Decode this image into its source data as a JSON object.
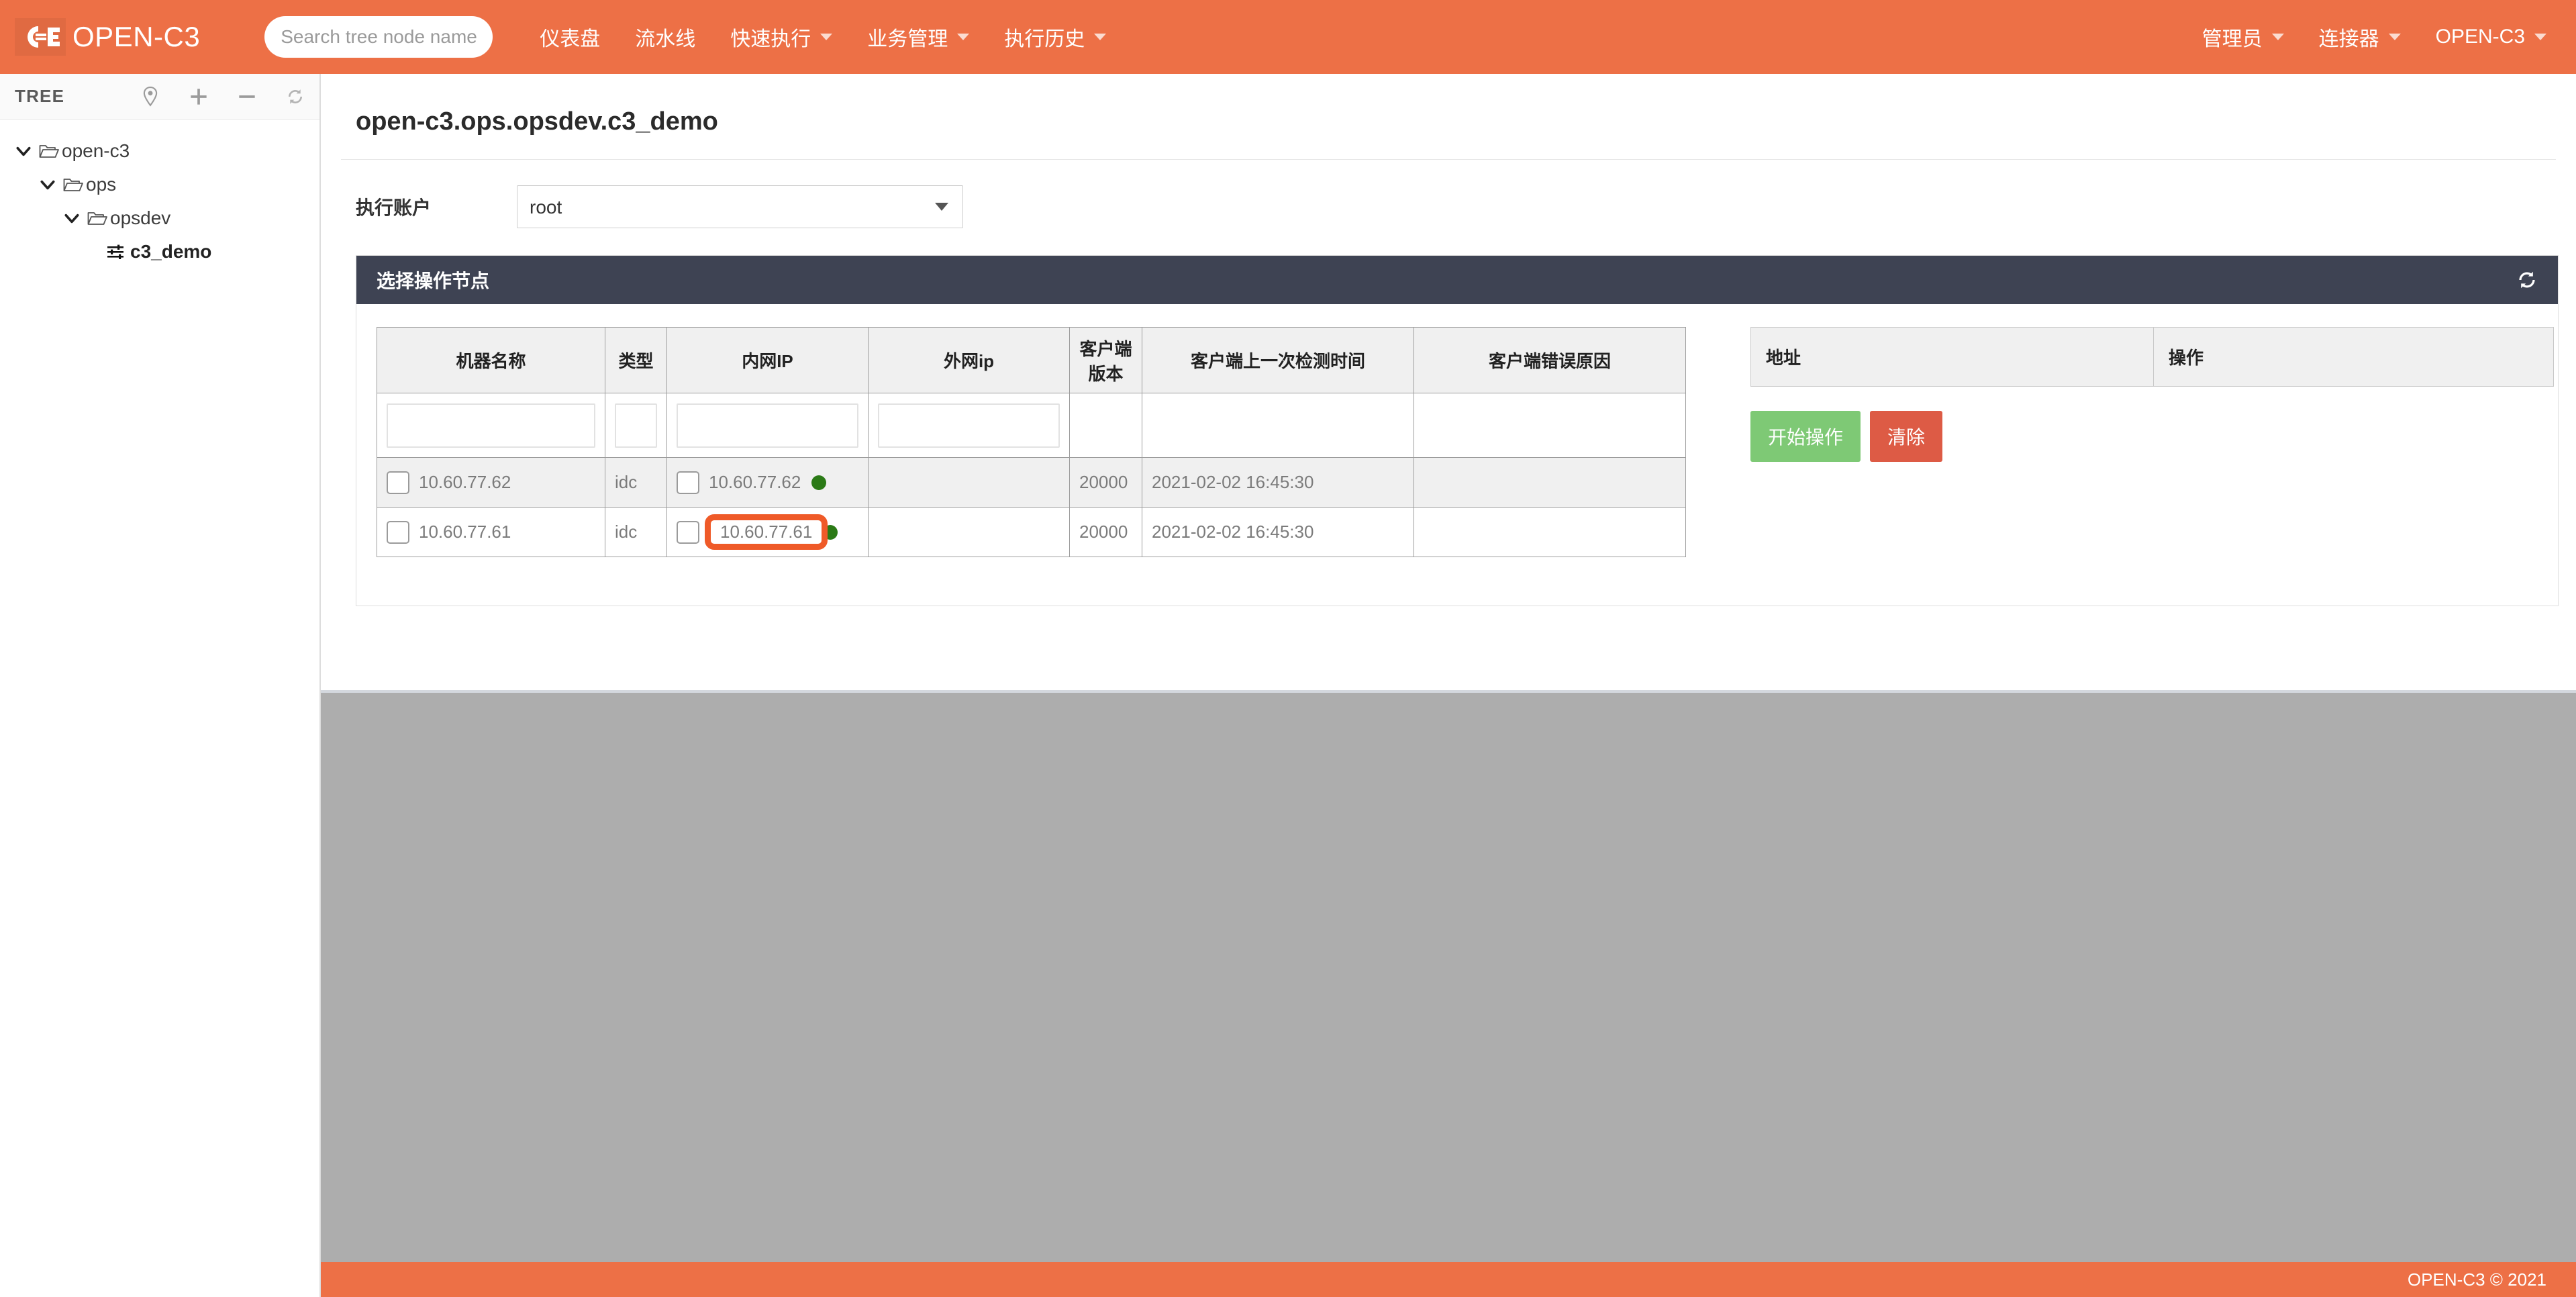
{
  "navbar": {
    "brand": "OPEN-C3",
    "logo_icon": "c3-logo-icon",
    "search": {
      "placeholder": "Search tree node name",
      "value": ""
    },
    "items": [
      {
        "label": "仪表盘",
        "has_caret": false
      },
      {
        "label": "流水线",
        "has_caret": false
      },
      {
        "label": "快速执行",
        "has_caret": true
      },
      {
        "label": "业务管理",
        "has_caret": true
      },
      {
        "label": "执行历史",
        "has_caret": true
      }
    ],
    "right_items": [
      {
        "label": "管理员",
        "has_caret": true
      },
      {
        "label": "连接器",
        "has_caret": true
      },
      {
        "label": "OPEN-C3",
        "has_caret": true
      }
    ]
  },
  "sidebar": {
    "title": "TREE",
    "tools": [
      {
        "icon": "location-pin-icon",
        "name": "locate-node-button"
      },
      {
        "icon": "plus-icon",
        "name": "add-node-button"
      },
      {
        "icon": "minus-icon",
        "name": "remove-node-button"
      },
      {
        "icon": "refresh-icon",
        "name": "refresh-tree-button"
      }
    ],
    "tree": [
      {
        "label": "open-c3",
        "depth": 0,
        "type": "folder",
        "expanded": true
      },
      {
        "label": "ops",
        "depth": 1,
        "type": "folder",
        "expanded": true
      },
      {
        "label": "opsdev",
        "depth": 2,
        "type": "folder",
        "expanded": true
      },
      {
        "label": "c3_demo",
        "depth": 3,
        "type": "leaf",
        "expanded": false
      }
    ]
  },
  "main": {
    "page_title": "open-c3.ops.opsdev.c3_demo",
    "account_form": {
      "label": "执行账户",
      "selected": "root",
      "options": [
        "root"
      ]
    },
    "panel": {
      "title": "选择操作节点",
      "refresh_icon": "refresh-icon"
    },
    "node_table": {
      "headers": [
        "机器名称",
        "类型",
        "内网IP",
        "外网ip",
        "客户端版本",
        "客户端上一次检测时间",
        "客户端错误原因"
      ],
      "filters": [
        "",
        "",
        "",
        ""
      ],
      "rows": [
        {
          "name": "10.60.77.62",
          "type": "idc",
          "inner_ip": "10.60.77.62",
          "outer_ip": "",
          "version": "20000",
          "last_check": "2021-02-02 16:45:30",
          "error": "",
          "status": "online",
          "highlighted": false,
          "checked": false
        },
        {
          "name": "10.60.77.61",
          "type": "idc",
          "inner_ip": "10.60.77.61",
          "outer_ip": "",
          "version": "20000",
          "last_check": "2021-02-02 16:45:30",
          "error": "",
          "status": "online",
          "highlighted": true,
          "checked": false
        }
      ]
    },
    "address_table": {
      "headers": [
        "地址",
        "操作"
      ],
      "rows": []
    },
    "buttons": {
      "start": "开始操作",
      "clear": "清除"
    }
  },
  "footer": {
    "text": "OPEN-C3 © 2021"
  },
  "colors": {
    "brand_orange": "#ed7046",
    "panel_header": "#3e4353",
    "highlight_outline": "#ef5a28",
    "status_online": "#2b7a16",
    "btn_start": "#7ec975",
    "btn_clear": "#dd5b45",
    "backdrop_grey": "#adadad"
  }
}
